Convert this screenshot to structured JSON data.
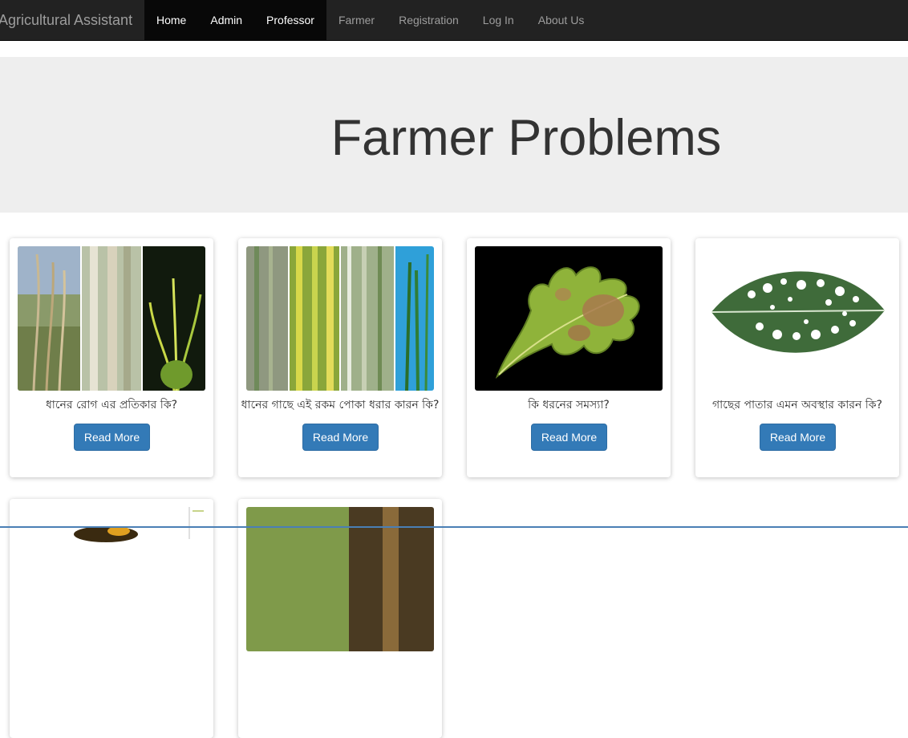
{
  "navbar": {
    "brand": "Agricultural Assistant",
    "items": [
      {
        "label": "Home",
        "active": true
      },
      {
        "label": "Admin",
        "active": true
      },
      {
        "label": "Professor",
        "active": true
      },
      {
        "label": "Farmer",
        "active": false
      },
      {
        "label": "Registration",
        "active": false
      },
      {
        "label": "Log In",
        "active": false
      },
      {
        "label": "About Us",
        "active": false
      }
    ]
  },
  "hero": {
    "title": "Farmer Problems"
  },
  "cards": [
    {
      "caption": "ধানের রোগ এর প্রতিকার কি?",
      "button": "Read More"
    },
    {
      "caption": "ধানের গাছে এই রকম পোকা ধরার কারন কি?",
      "button": "Read More"
    },
    {
      "caption": "কি ধরনের সমস্যা?",
      "button": "Read More"
    },
    {
      "caption": "গাছের পাতার এমন অবস্থার কারন কি?",
      "button": "Read More"
    }
  ],
  "colors": {
    "navbar_bg": "#222222",
    "nav_active_bg": "#080808",
    "hero_bg": "#eeeeee",
    "button_primary": "#337ab7"
  }
}
